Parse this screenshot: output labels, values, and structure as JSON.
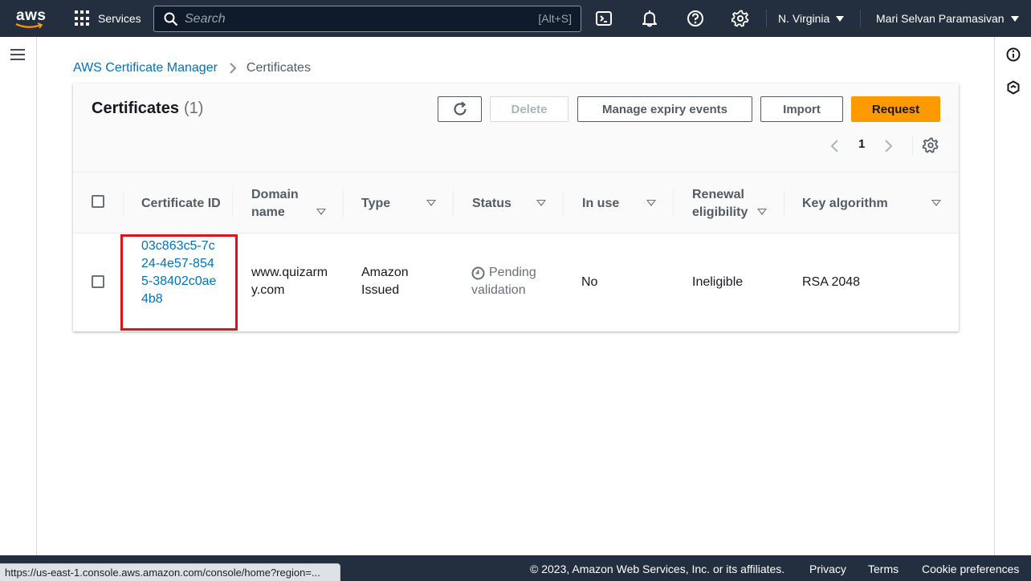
{
  "topnav": {
    "logo_text": "aws",
    "services_label": "Services",
    "search_placeholder": "Search",
    "search_shortcut": "[Alt+S]",
    "region": "N. Virginia",
    "user": "Mari Selvan Paramasivan"
  },
  "breadcrumb": {
    "parent": "AWS Certificate Manager",
    "current": "Certificates"
  },
  "card": {
    "title": "Certificates",
    "count": "(1)",
    "buttons": {
      "delete": "Delete",
      "manage": "Manage expiry events",
      "import": "Import",
      "request": "Request"
    },
    "pager": {
      "page": "1"
    }
  },
  "table": {
    "headers": {
      "cert_id": "Certificate ID",
      "domain": "Domain name",
      "type": "Type",
      "status": "Status",
      "in_use": "In use",
      "renewal": "Renewal eligibility",
      "key_alg": "Key algorithm"
    },
    "rows": [
      {
        "cert_id": "03c863c5-7c24-4e57-8545-38402c0ae4b8",
        "domain": "www.quizarmy.com",
        "type": "Amazon Issued",
        "status": "Pending validation",
        "in_use": "No",
        "renewal": "Ineligible",
        "key_alg": "RSA 2048"
      }
    ]
  },
  "footer": {
    "copyright": "© 2023, Amazon Web Services, Inc. or its affiliates.",
    "privacy": "Privacy",
    "terms": "Terms",
    "cookies": "Cookie preferences"
  },
  "status_bar": {
    "url": "https://us-east-1.console.aws.amazon.com/console/home?region=..."
  },
  "colors": {
    "nav_bg": "#232f3e",
    "link": "#0073bb",
    "primary": "#ff9900",
    "highlight": "#d91515"
  }
}
